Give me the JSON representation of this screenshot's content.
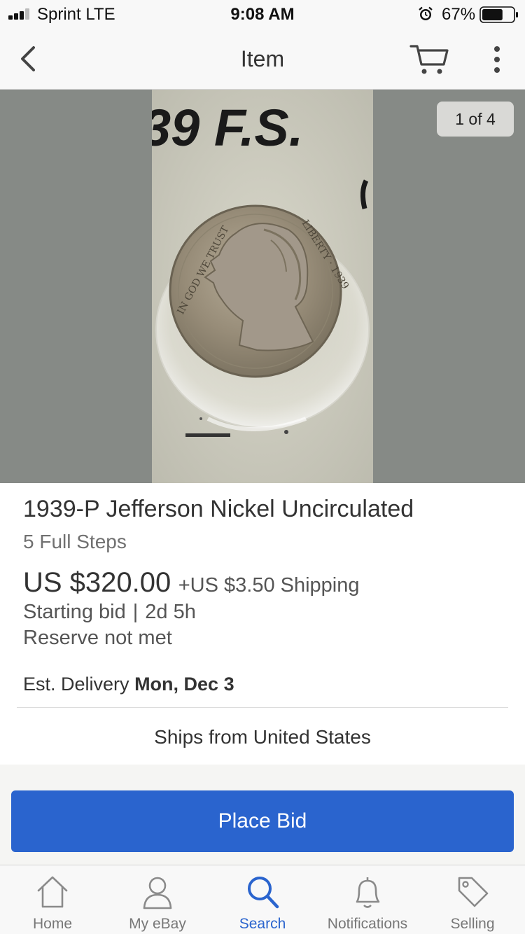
{
  "status_bar": {
    "carrier": "Sprint  LTE",
    "time": "9:08 AM",
    "battery_percent": "67%",
    "battery_level": 0.67,
    "signal_bars": 3
  },
  "nav": {
    "title": "Item",
    "icons": [
      "chevron-left-icon",
      "cart-icon",
      "more-vertical-icon"
    ]
  },
  "image": {
    "counter": "1 of 4",
    "handwritten_text": "39 F.S."
  },
  "listing": {
    "title": "1939-P Jefferson Nickel Uncirculated",
    "subtitle": "5 Full Steps",
    "price": "US $320.00",
    "shipping": "+US $3.50 Shipping",
    "bid_type": "Starting bid",
    "bid_separator": "|",
    "time_left": "2d 5h",
    "reserve": "Reserve not met",
    "delivery_label": "Est. Delivery",
    "delivery_date": "Mon, Dec 3",
    "ships_from": "Ships from United States"
  },
  "actions": {
    "place_bid": "Place Bid",
    "accent_color": "#2a64ce"
  },
  "tabs": [
    {
      "label": "Home",
      "icon": "home-icon",
      "active": false
    },
    {
      "label": "My eBay",
      "icon": "user-icon",
      "active": false
    },
    {
      "label": "Search",
      "icon": "search-icon",
      "active": true
    },
    {
      "label": "Notifications",
      "icon": "bell-icon",
      "active": false
    },
    {
      "label": "Selling",
      "icon": "tag-icon",
      "active": false
    }
  ]
}
